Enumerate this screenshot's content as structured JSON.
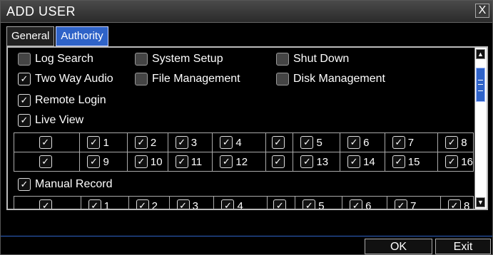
{
  "dialog": {
    "title": "ADD USER",
    "close_label": "X"
  },
  "tabs": [
    {
      "label": "General",
      "active": false
    },
    {
      "label": "Authority",
      "active": true
    }
  ],
  "permissions": {
    "log_search": {
      "label": "Log Search",
      "checked": false
    },
    "system_setup": {
      "label": "System Setup",
      "checked": false
    },
    "shut_down": {
      "label": "Shut Down",
      "checked": false
    },
    "two_way_audio": {
      "label": "Two Way Audio",
      "checked": true
    },
    "file_management": {
      "label": "File Management",
      "checked": false
    },
    "disk_management": {
      "label": "Disk Management",
      "checked": false
    },
    "remote_login": {
      "label": "Remote Login",
      "checked": true
    },
    "live_view": {
      "label": "Live View",
      "checked": true
    },
    "manual_record": {
      "label": "Manual Record",
      "checked": true
    }
  },
  "live_view_channels": {
    "row1": [
      "1",
      "2",
      "3",
      "4",
      "5",
      "6",
      "7",
      "8"
    ],
    "row2": [
      "9",
      "10",
      "11",
      "12",
      "13",
      "14",
      "15",
      "16"
    ]
  },
  "manual_record_channels": {
    "row1": [
      "1",
      "2",
      "3",
      "4",
      "5",
      "6",
      "7",
      "8"
    ]
  },
  "buttons": {
    "ok": "OK",
    "exit": "Exit"
  },
  "colors": {
    "accent": "#2f63c8",
    "background": "#000000",
    "text": "#ffffff"
  }
}
